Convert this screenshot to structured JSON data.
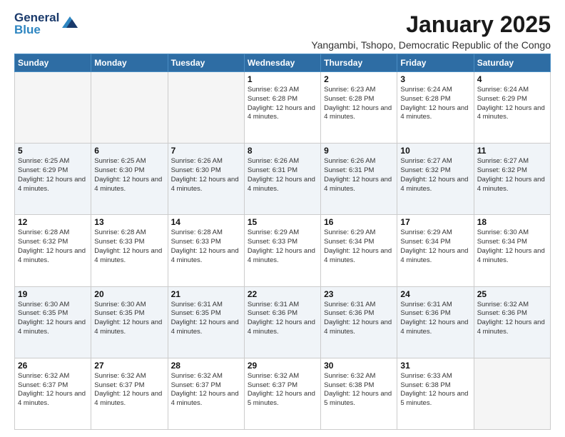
{
  "header": {
    "logo_line1": "General",
    "logo_line2": "Blue",
    "month_title": "January 2025",
    "subtitle": "Yangambi, Tshopo, Democratic Republic of the Congo"
  },
  "days_of_week": [
    "Sunday",
    "Monday",
    "Tuesday",
    "Wednesday",
    "Thursday",
    "Friday",
    "Saturday"
  ],
  "weeks": [
    [
      {
        "day": "",
        "info": ""
      },
      {
        "day": "",
        "info": ""
      },
      {
        "day": "",
        "info": ""
      },
      {
        "day": "1",
        "info": "Sunrise: 6:23 AM\nSunset: 6:28 PM\nDaylight: 12 hours and 4 minutes."
      },
      {
        "day": "2",
        "info": "Sunrise: 6:23 AM\nSunset: 6:28 PM\nDaylight: 12 hours and 4 minutes."
      },
      {
        "day": "3",
        "info": "Sunrise: 6:24 AM\nSunset: 6:28 PM\nDaylight: 12 hours and 4 minutes."
      },
      {
        "day": "4",
        "info": "Sunrise: 6:24 AM\nSunset: 6:29 PM\nDaylight: 12 hours and 4 minutes."
      }
    ],
    [
      {
        "day": "5",
        "info": "Sunrise: 6:25 AM\nSunset: 6:29 PM\nDaylight: 12 hours and 4 minutes."
      },
      {
        "day": "6",
        "info": "Sunrise: 6:25 AM\nSunset: 6:30 PM\nDaylight: 12 hours and 4 minutes."
      },
      {
        "day": "7",
        "info": "Sunrise: 6:26 AM\nSunset: 6:30 PM\nDaylight: 12 hours and 4 minutes."
      },
      {
        "day": "8",
        "info": "Sunrise: 6:26 AM\nSunset: 6:31 PM\nDaylight: 12 hours and 4 minutes."
      },
      {
        "day": "9",
        "info": "Sunrise: 6:26 AM\nSunset: 6:31 PM\nDaylight: 12 hours and 4 minutes."
      },
      {
        "day": "10",
        "info": "Sunrise: 6:27 AM\nSunset: 6:32 PM\nDaylight: 12 hours and 4 minutes."
      },
      {
        "day": "11",
        "info": "Sunrise: 6:27 AM\nSunset: 6:32 PM\nDaylight: 12 hours and 4 minutes."
      }
    ],
    [
      {
        "day": "12",
        "info": "Sunrise: 6:28 AM\nSunset: 6:32 PM\nDaylight: 12 hours and 4 minutes."
      },
      {
        "day": "13",
        "info": "Sunrise: 6:28 AM\nSunset: 6:33 PM\nDaylight: 12 hours and 4 minutes."
      },
      {
        "day": "14",
        "info": "Sunrise: 6:28 AM\nSunset: 6:33 PM\nDaylight: 12 hours and 4 minutes."
      },
      {
        "day": "15",
        "info": "Sunrise: 6:29 AM\nSunset: 6:33 PM\nDaylight: 12 hours and 4 minutes."
      },
      {
        "day": "16",
        "info": "Sunrise: 6:29 AM\nSunset: 6:34 PM\nDaylight: 12 hours and 4 minutes."
      },
      {
        "day": "17",
        "info": "Sunrise: 6:29 AM\nSunset: 6:34 PM\nDaylight: 12 hours and 4 minutes."
      },
      {
        "day": "18",
        "info": "Sunrise: 6:30 AM\nSunset: 6:34 PM\nDaylight: 12 hours and 4 minutes."
      }
    ],
    [
      {
        "day": "19",
        "info": "Sunrise: 6:30 AM\nSunset: 6:35 PM\nDaylight: 12 hours and 4 minutes."
      },
      {
        "day": "20",
        "info": "Sunrise: 6:30 AM\nSunset: 6:35 PM\nDaylight: 12 hours and 4 minutes."
      },
      {
        "day": "21",
        "info": "Sunrise: 6:31 AM\nSunset: 6:35 PM\nDaylight: 12 hours and 4 minutes."
      },
      {
        "day": "22",
        "info": "Sunrise: 6:31 AM\nSunset: 6:36 PM\nDaylight: 12 hours and 4 minutes."
      },
      {
        "day": "23",
        "info": "Sunrise: 6:31 AM\nSunset: 6:36 PM\nDaylight: 12 hours and 4 minutes."
      },
      {
        "day": "24",
        "info": "Sunrise: 6:31 AM\nSunset: 6:36 PM\nDaylight: 12 hours and 4 minutes."
      },
      {
        "day": "25",
        "info": "Sunrise: 6:32 AM\nSunset: 6:36 PM\nDaylight: 12 hours and 4 minutes."
      }
    ],
    [
      {
        "day": "26",
        "info": "Sunrise: 6:32 AM\nSunset: 6:37 PM\nDaylight: 12 hours and 4 minutes."
      },
      {
        "day": "27",
        "info": "Sunrise: 6:32 AM\nSunset: 6:37 PM\nDaylight: 12 hours and 4 minutes."
      },
      {
        "day": "28",
        "info": "Sunrise: 6:32 AM\nSunset: 6:37 PM\nDaylight: 12 hours and 4 minutes."
      },
      {
        "day": "29",
        "info": "Sunrise: 6:32 AM\nSunset: 6:37 PM\nDaylight: 12 hours and 5 minutes."
      },
      {
        "day": "30",
        "info": "Sunrise: 6:32 AM\nSunset: 6:38 PM\nDaylight: 12 hours and 5 minutes."
      },
      {
        "day": "31",
        "info": "Sunrise: 6:33 AM\nSunset: 6:38 PM\nDaylight: 12 hours and 5 minutes."
      },
      {
        "day": "",
        "info": ""
      }
    ]
  ]
}
